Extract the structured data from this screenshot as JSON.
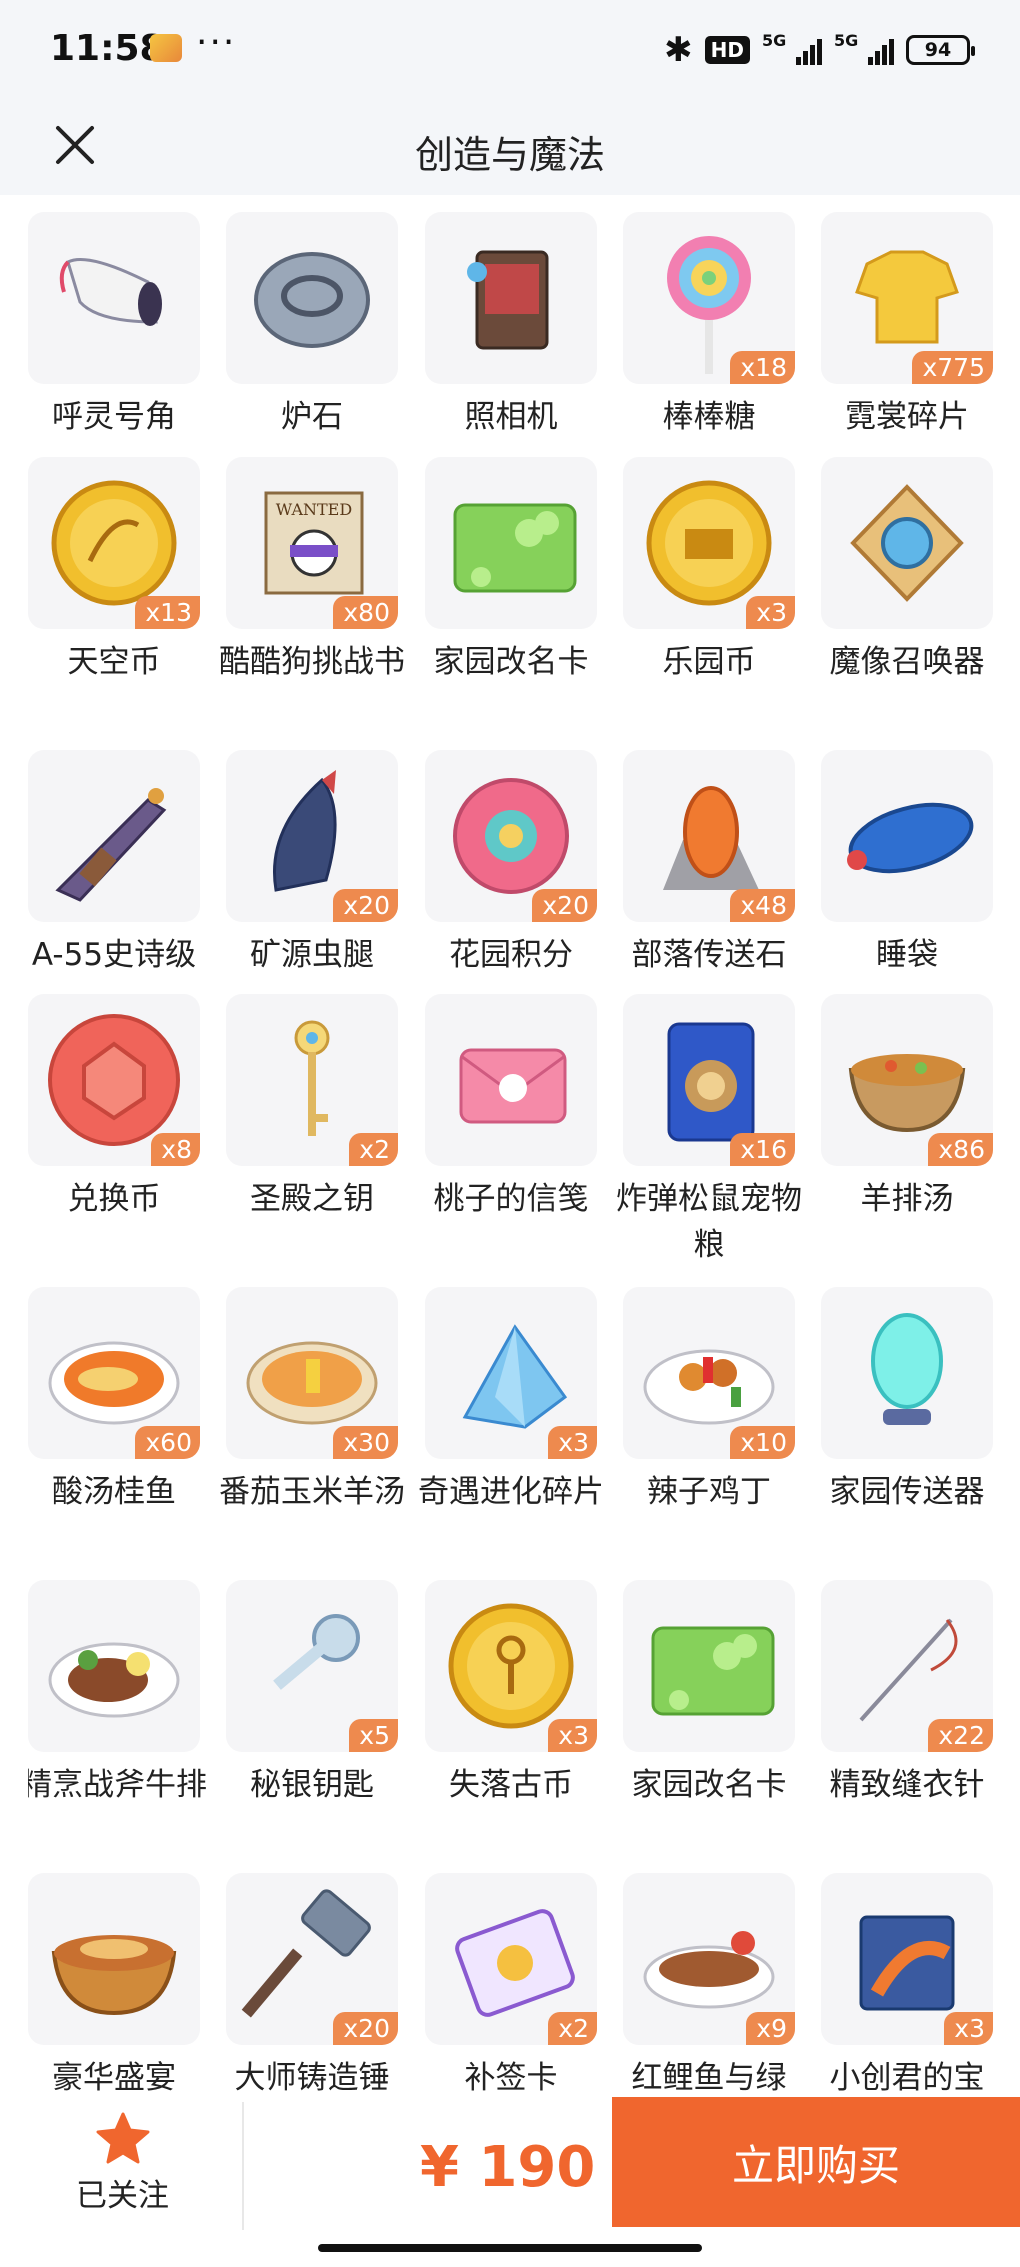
{
  "status_bar": {
    "time": "11:58",
    "dots": "···",
    "hd": "HD",
    "net1": "5G",
    "net2": "5G",
    "battery": "94"
  },
  "header": {
    "title": "创造与魔法"
  },
  "items": [
    {
      "name": "呼灵号角",
      "count": "",
      "icon": "horn-icon"
    },
    {
      "name": "炉石",
      "count": "",
      "icon": "hearthstone-icon"
    },
    {
      "name": "照相机",
      "count": "",
      "icon": "camera-icon"
    },
    {
      "name": "棒棒糖",
      "count": "x18",
      "icon": "lollipop-icon"
    },
    {
      "name": "霓裳碎片",
      "count": "x775",
      "icon": "shirt-fragment-icon"
    },
    {
      "name": "天空币",
      "count": "x13",
      "icon": "sky-coin-icon"
    },
    {
      "name": "酷酷狗挑战书",
      "count": "x80",
      "icon": "wanted-poster-icon"
    },
    {
      "name": "家园改名卡",
      "count": "",
      "icon": "rename-card-icon"
    },
    {
      "name": "乐园币",
      "count": "x3",
      "icon": "park-coin-icon"
    },
    {
      "name": "魔像召唤器",
      "count": "",
      "icon": "golem-summoner-icon"
    },
    {
      "name": "A-55史诗级",
      "count": "",
      "icon": "rifle-icon"
    },
    {
      "name": "矿源虫腿",
      "count": "x20",
      "icon": "bug-leg-icon"
    },
    {
      "name": "花园积分",
      "count": "x20",
      "icon": "garden-points-icon"
    },
    {
      "name": "部落传送石",
      "count": "x48",
      "icon": "tribe-stone-icon"
    },
    {
      "name": "睡袋",
      "count": "",
      "icon": "sleeping-bag-icon"
    },
    {
      "name": "兑换币",
      "count": "x8",
      "icon": "exchange-coin-icon"
    },
    {
      "name": "圣殿之钥",
      "count": "x2",
      "icon": "temple-key-icon"
    },
    {
      "name": "桃子的信笺",
      "count": "",
      "icon": "letter-icon"
    },
    {
      "name": "炸弹松鼠宠物粮",
      "count": "x16",
      "icon": "pet-food-icon"
    },
    {
      "name": "羊排汤",
      "count": "x86",
      "icon": "soup-icon"
    },
    {
      "name": "酸汤桂鱼",
      "count": "x60",
      "icon": "fish-dish-icon"
    },
    {
      "name": "番茄玉米羊汤",
      "count": "x30",
      "icon": "corn-soup-icon"
    },
    {
      "name": "奇遇进化碎片",
      "count": "x3",
      "icon": "crystal-fragment-icon"
    },
    {
      "name": "辣子鸡丁",
      "count": "x10",
      "icon": "chicken-dish-icon"
    },
    {
      "name": "家园传送器",
      "count": "",
      "icon": "home-teleporter-icon"
    },
    {
      "name": "精烹战斧牛排",
      "count": "",
      "icon": "steak-icon"
    },
    {
      "name": "秘银钥匙",
      "count": "x5",
      "icon": "mithril-key-icon"
    },
    {
      "name": "失落古币",
      "count": "x3",
      "icon": "ancient-coin-icon"
    },
    {
      "name": "家园改名卡",
      "count": "",
      "icon": "rename-card-icon"
    },
    {
      "name": "精致缝衣针",
      "count": "x22",
      "icon": "needle-icon"
    },
    {
      "name": "豪华盛宴",
      "count": "",
      "icon": "feast-icon"
    },
    {
      "name": "大师铸造锤",
      "count": "x20",
      "icon": "hammer-icon"
    },
    {
      "name": "补签卡",
      "count": "x2",
      "icon": "makeup-card-icon"
    },
    {
      "name": "红鲤鱼与绿",
      "count": "x9",
      "icon": "carp-dish-icon"
    },
    {
      "name": "小创君的宝",
      "count": "x3",
      "icon": "puzzle-icon"
    }
  ],
  "bottom": {
    "follow_label": "已关注",
    "price": "¥ 190",
    "buy_label": "立即购买"
  },
  "colors": {
    "accent": "#f0662e",
    "badge": "#ee8a4e",
    "header_bg": "#f4f6f9"
  }
}
